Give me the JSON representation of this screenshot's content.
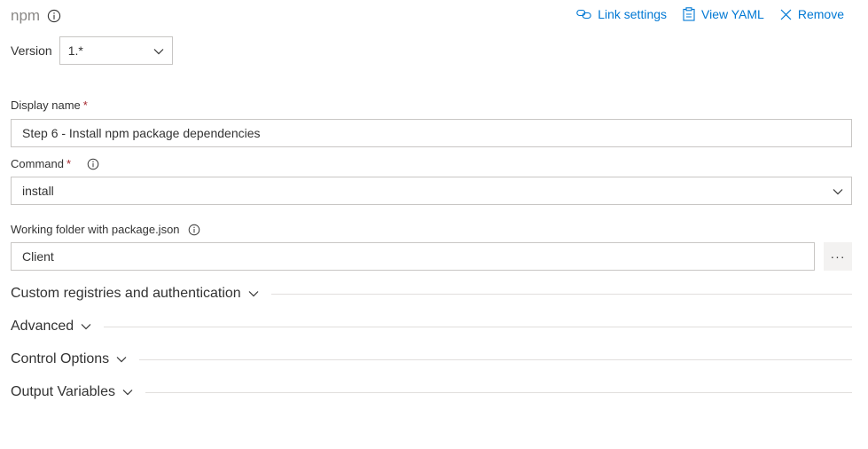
{
  "header": {
    "title": "npm",
    "actions": {
      "link_settings": "Link settings",
      "view_yaml": "View YAML",
      "remove": "Remove"
    }
  },
  "version": {
    "label": "Version",
    "value": "1.*"
  },
  "display_name": {
    "label": "Display name",
    "required_mark": "*",
    "value": "Step 6 - Install npm package dependencies"
  },
  "command": {
    "label": "Command",
    "required_mark": "*",
    "value": "install"
  },
  "working_folder": {
    "label": "Working folder with package.json",
    "value": "Client",
    "browse_label": "···"
  },
  "sections": [
    {
      "label": "Custom registries and authentication"
    },
    {
      "label": "Advanced"
    },
    {
      "label": "Control Options"
    },
    {
      "label": "Output Variables"
    }
  ],
  "colors": {
    "accent": "#0078d4",
    "required": "#a4262c",
    "border": "#c8c6c4"
  }
}
